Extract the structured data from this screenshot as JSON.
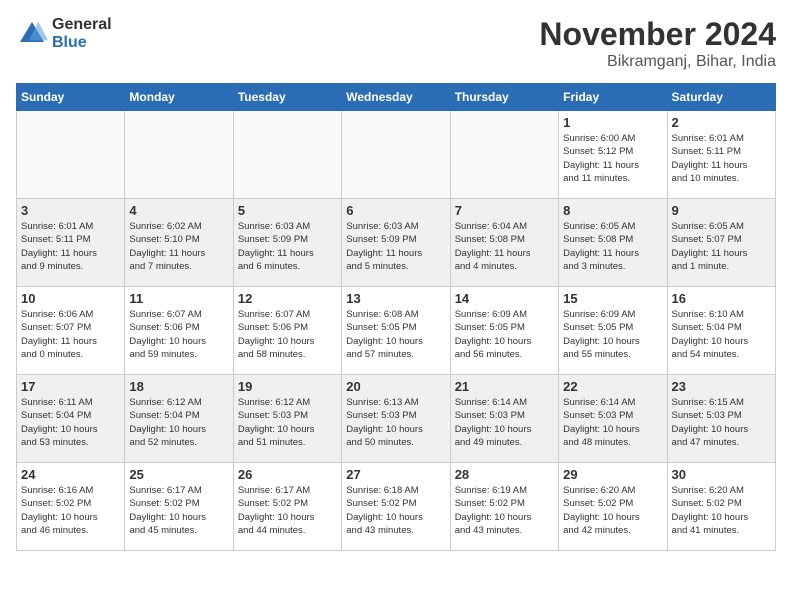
{
  "header": {
    "logo_general": "General",
    "logo_blue": "Blue",
    "month_title": "November 2024",
    "location": "Bikramganj, Bihar, India"
  },
  "weekdays": [
    "Sunday",
    "Monday",
    "Tuesday",
    "Wednesday",
    "Thursday",
    "Friday",
    "Saturday"
  ],
  "weeks": [
    [
      {
        "day": "",
        "info": ""
      },
      {
        "day": "",
        "info": ""
      },
      {
        "day": "",
        "info": ""
      },
      {
        "day": "",
        "info": ""
      },
      {
        "day": "",
        "info": ""
      },
      {
        "day": "1",
        "info": "Sunrise: 6:00 AM\nSunset: 5:12 PM\nDaylight: 11 hours\nand 11 minutes."
      },
      {
        "day": "2",
        "info": "Sunrise: 6:01 AM\nSunset: 5:11 PM\nDaylight: 11 hours\nand 10 minutes."
      }
    ],
    [
      {
        "day": "3",
        "info": "Sunrise: 6:01 AM\nSunset: 5:11 PM\nDaylight: 11 hours\nand 9 minutes."
      },
      {
        "day": "4",
        "info": "Sunrise: 6:02 AM\nSunset: 5:10 PM\nDaylight: 11 hours\nand 7 minutes."
      },
      {
        "day": "5",
        "info": "Sunrise: 6:03 AM\nSunset: 5:09 PM\nDaylight: 11 hours\nand 6 minutes."
      },
      {
        "day": "6",
        "info": "Sunrise: 6:03 AM\nSunset: 5:09 PM\nDaylight: 11 hours\nand 5 minutes."
      },
      {
        "day": "7",
        "info": "Sunrise: 6:04 AM\nSunset: 5:08 PM\nDaylight: 11 hours\nand 4 minutes."
      },
      {
        "day": "8",
        "info": "Sunrise: 6:05 AM\nSunset: 5:08 PM\nDaylight: 11 hours\nand 3 minutes."
      },
      {
        "day": "9",
        "info": "Sunrise: 6:05 AM\nSunset: 5:07 PM\nDaylight: 11 hours\nand 1 minute."
      }
    ],
    [
      {
        "day": "10",
        "info": "Sunrise: 6:06 AM\nSunset: 5:07 PM\nDaylight: 11 hours\nand 0 minutes."
      },
      {
        "day": "11",
        "info": "Sunrise: 6:07 AM\nSunset: 5:06 PM\nDaylight: 10 hours\nand 59 minutes."
      },
      {
        "day": "12",
        "info": "Sunrise: 6:07 AM\nSunset: 5:06 PM\nDaylight: 10 hours\nand 58 minutes."
      },
      {
        "day": "13",
        "info": "Sunrise: 6:08 AM\nSunset: 5:05 PM\nDaylight: 10 hours\nand 57 minutes."
      },
      {
        "day": "14",
        "info": "Sunrise: 6:09 AM\nSunset: 5:05 PM\nDaylight: 10 hours\nand 56 minutes."
      },
      {
        "day": "15",
        "info": "Sunrise: 6:09 AM\nSunset: 5:05 PM\nDaylight: 10 hours\nand 55 minutes."
      },
      {
        "day": "16",
        "info": "Sunrise: 6:10 AM\nSunset: 5:04 PM\nDaylight: 10 hours\nand 54 minutes."
      }
    ],
    [
      {
        "day": "17",
        "info": "Sunrise: 6:11 AM\nSunset: 5:04 PM\nDaylight: 10 hours\nand 53 minutes."
      },
      {
        "day": "18",
        "info": "Sunrise: 6:12 AM\nSunset: 5:04 PM\nDaylight: 10 hours\nand 52 minutes."
      },
      {
        "day": "19",
        "info": "Sunrise: 6:12 AM\nSunset: 5:03 PM\nDaylight: 10 hours\nand 51 minutes."
      },
      {
        "day": "20",
        "info": "Sunrise: 6:13 AM\nSunset: 5:03 PM\nDaylight: 10 hours\nand 50 minutes."
      },
      {
        "day": "21",
        "info": "Sunrise: 6:14 AM\nSunset: 5:03 PM\nDaylight: 10 hours\nand 49 minutes."
      },
      {
        "day": "22",
        "info": "Sunrise: 6:14 AM\nSunset: 5:03 PM\nDaylight: 10 hours\nand 48 minutes."
      },
      {
        "day": "23",
        "info": "Sunrise: 6:15 AM\nSunset: 5:03 PM\nDaylight: 10 hours\nand 47 minutes."
      }
    ],
    [
      {
        "day": "24",
        "info": "Sunrise: 6:16 AM\nSunset: 5:02 PM\nDaylight: 10 hours\nand 46 minutes."
      },
      {
        "day": "25",
        "info": "Sunrise: 6:17 AM\nSunset: 5:02 PM\nDaylight: 10 hours\nand 45 minutes."
      },
      {
        "day": "26",
        "info": "Sunrise: 6:17 AM\nSunset: 5:02 PM\nDaylight: 10 hours\nand 44 minutes."
      },
      {
        "day": "27",
        "info": "Sunrise: 6:18 AM\nSunset: 5:02 PM\nDaylight: 10 hours\nand 43 minutes."
      },
      {
        "day": "28",
        "info": "Sunrise: 6:19 AM\nSunset: 5:02 PM\nDaylight: 10 hours\nand 43 minutes."
      },
      {
        "day": "29",
        "info": "Sunrise: 6:20 AM\nSunset: 5:02 PM\nDaylight: 10 hours\nand 42 minutes."
      },
      {
        "day": "30",
        "info": "Sunrise: 6:20 AM\nSunset: 5:02 PM\nDaylight: 10 hours\nand 41 minutes."
      }
    ]
  ]
}
